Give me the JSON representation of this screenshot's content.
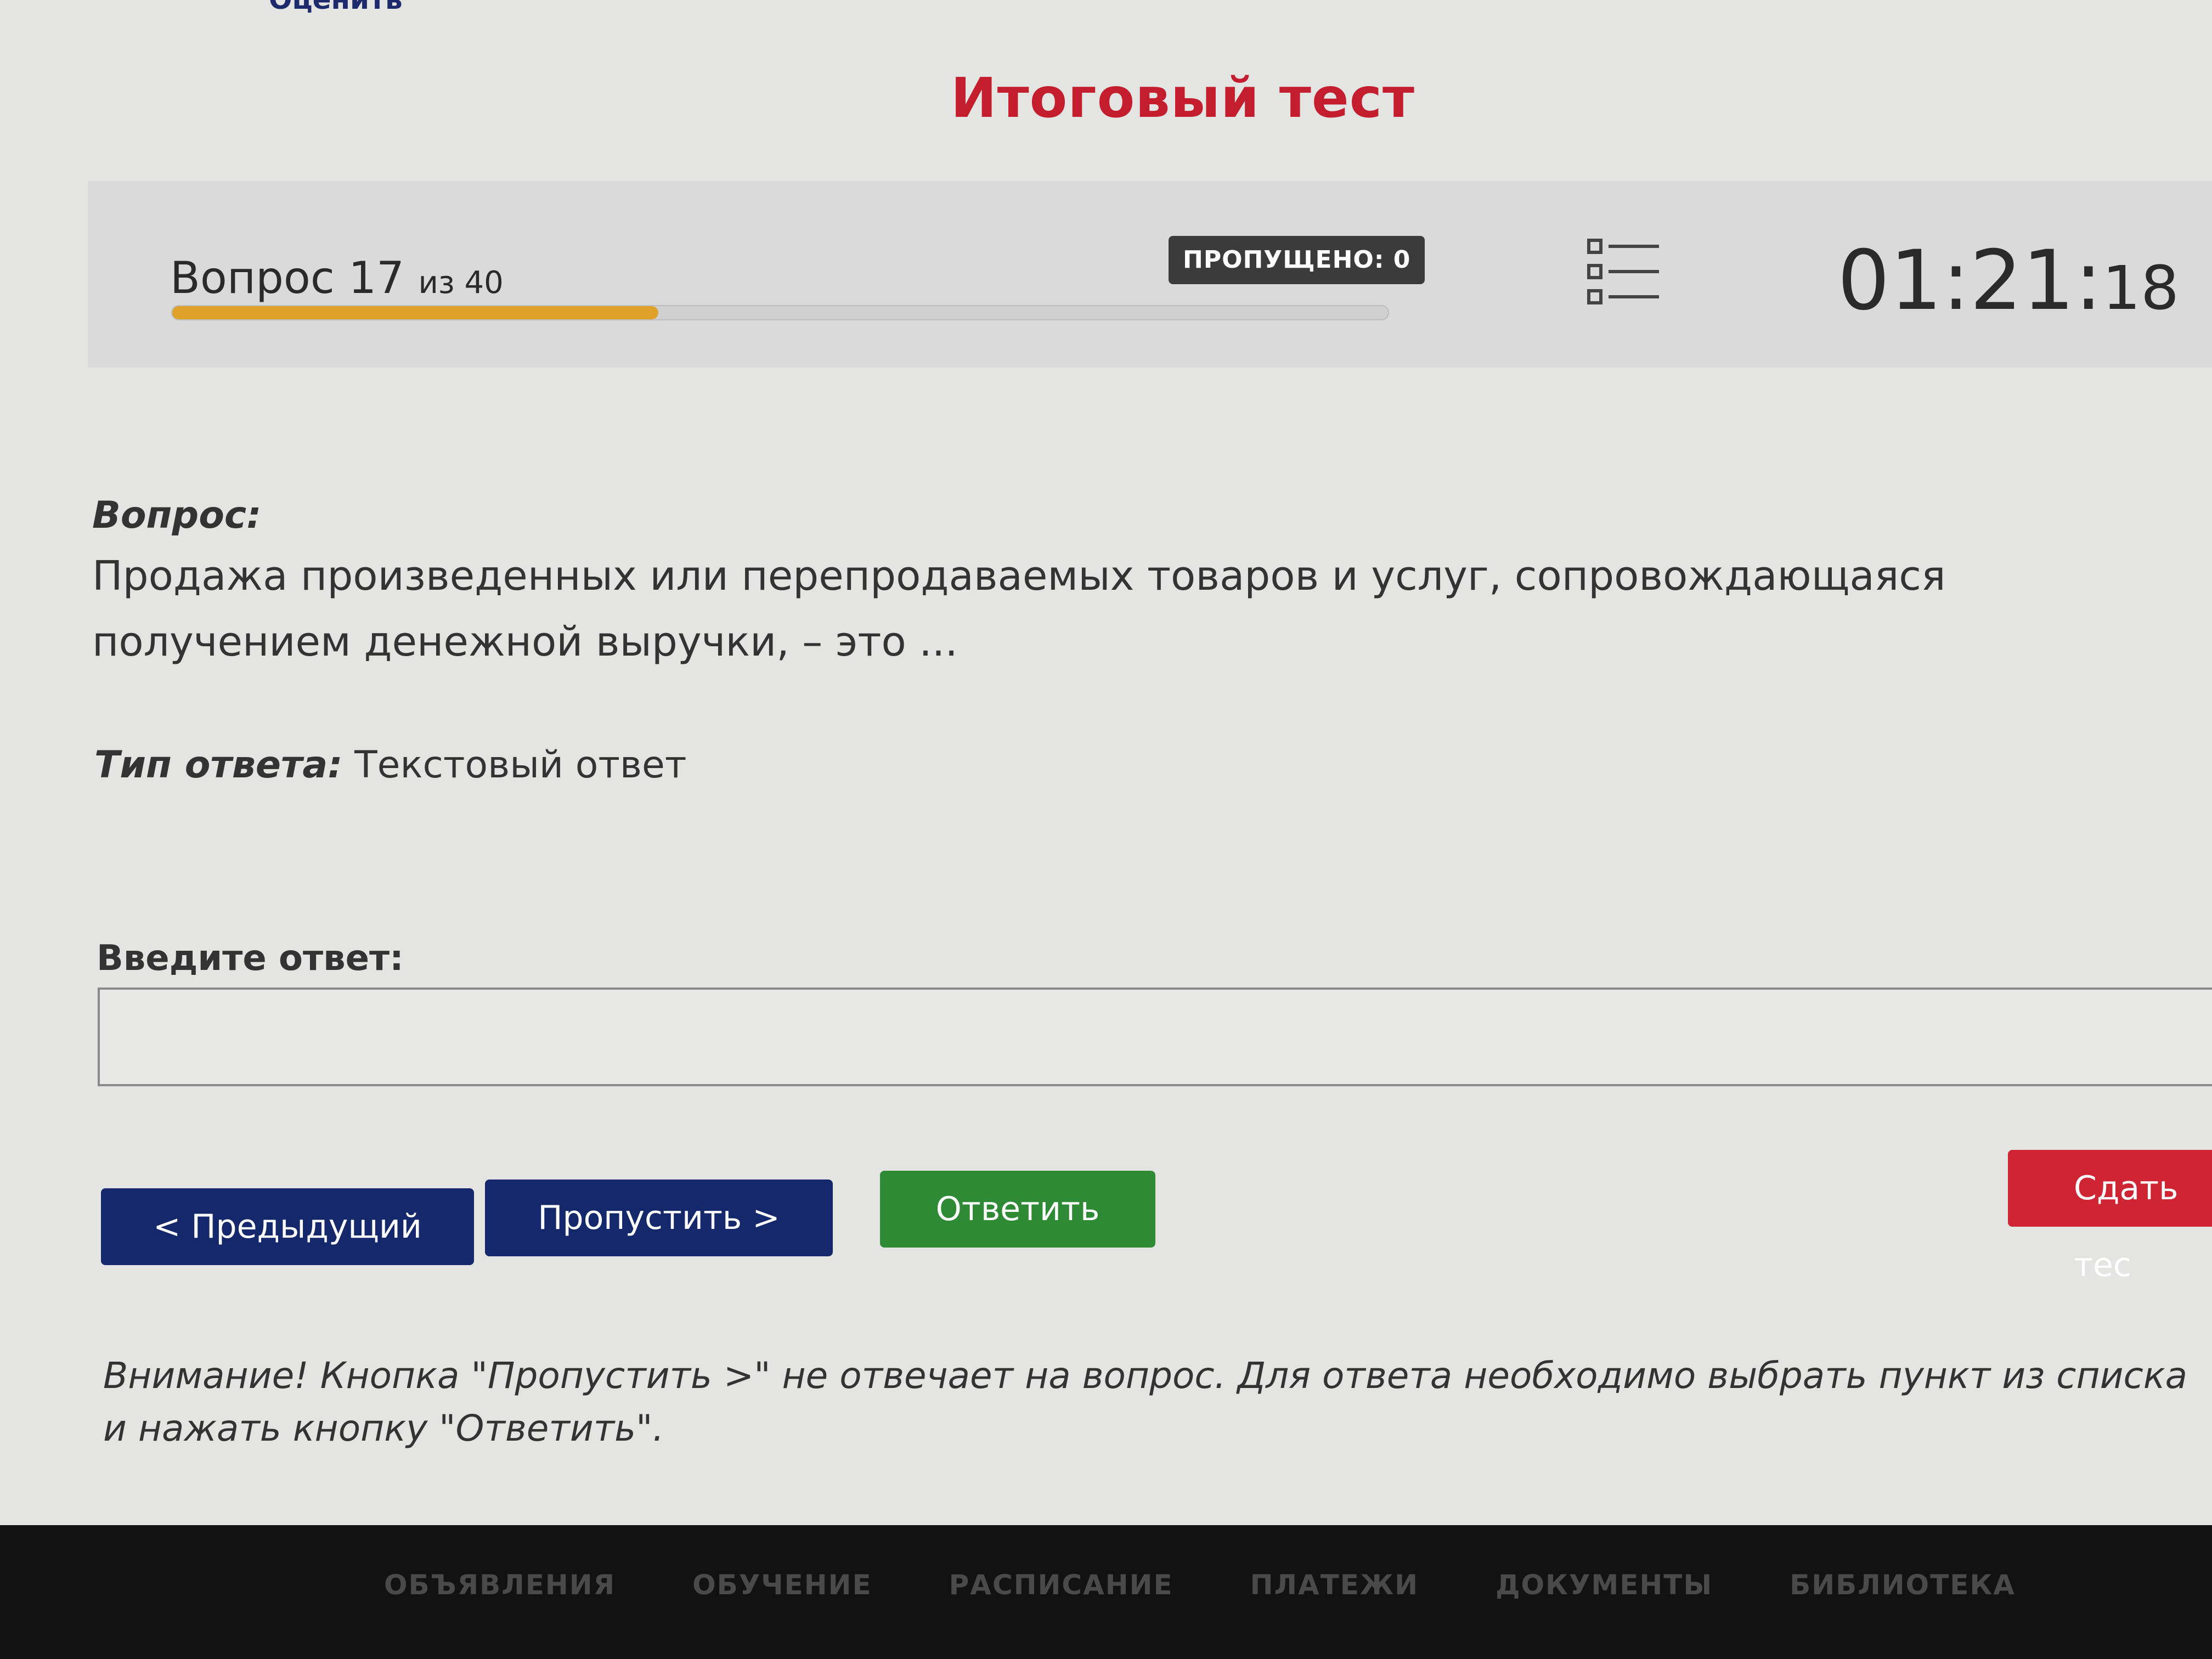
{
  "header": {
    "top_link": "Оценить",
    "title": "Итоговый тест"
  },
  "status": {
    "question_label": "Вопрос 17",
    "question_of": "из 40",
    "progress": 0.4,
    "skipped_badge": "ПРОПУЩЕНО: 0",
    "timer_main": "01:21:",
    "timer_seconds": "18",
    "progress_color": "#e0a12a"
  },
  "question": {
    "label": "Вопрос:",
    "text": "Продажа произведенных или перепродаваемых товаров и услуг, сопровождающаяся получением денежной выручки, – это ...",
    "answer_type_label": "Тип ответа:",
    "answer_type_value": "Текстовый ответ"
  },
  "answer": {
    "label": "Введите ответ:",
    "value": ""
  },
  "buttons": {
    "prev": "< Предыдущий",
    "skip": "Пропустить >",
    "answer": "Ответить",
    "submit": "Сдать тес"
  },
  "warning": "Внимание! Кнопка \"Пропустить >\" не отвечает на вопрос. Для ответа необходимо выбрать пункт из списка и нажать кнопку \"Ответить\".",
  "footer_nav": [
    "ОБЪЯВЛЕНИЯ",
    "ОБУЧЕНИЕ",
    "РАСПИСАНИЕ",
    "ПЛАТЕЖИ",
    "ДОКУМЕНТЫ",
    "БИБЛИОТЕКА"
  ],
  "colors": {
    "title_red": "#c41d2e",
    "nav_blue": "#14286b",
    "answer_green": "#2f8a36",
    "submit_red": "#cf2433"
  }
}
